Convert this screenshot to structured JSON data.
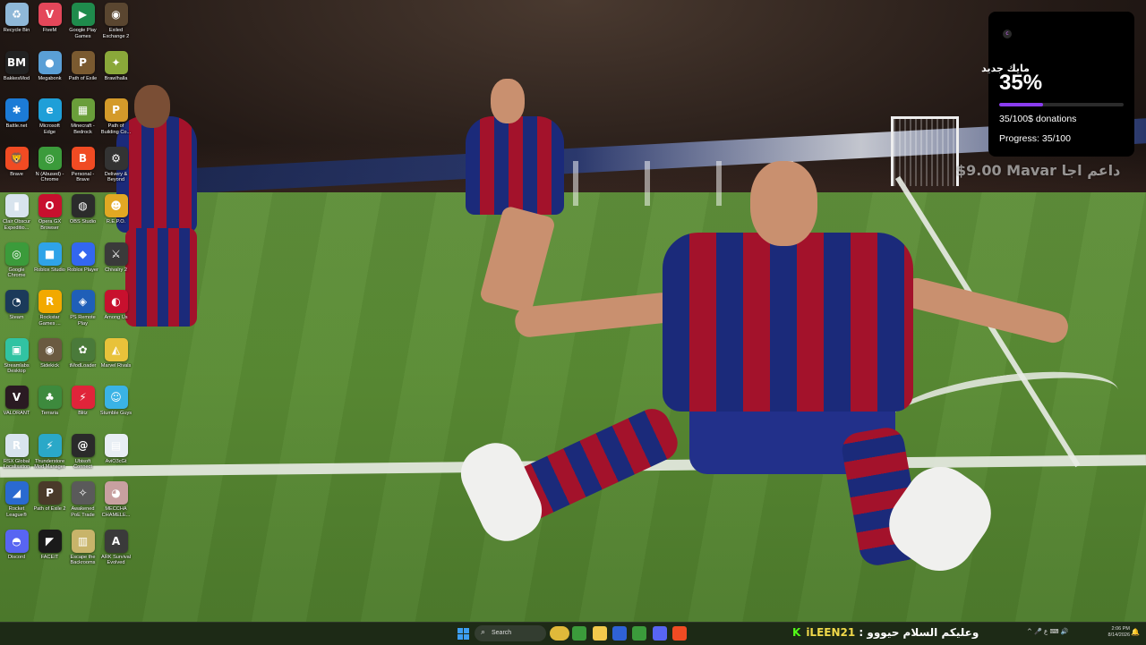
{
  "desktop_icons": [
    {
      "label": "Recycle Bin",
      "icon": "recycle-bin-icon",
      "color": "#8fb8d8",
      "glyph": "♻"
    },
    {
      "label": "FiveM",
      "icon": "fivem-icon",
      "color": "#e4475a",
      "glyph": "V"
    },
    {
      "label": "Google Play Games",
      "icon": "google-play-games-icon",
      "color": "#1f8b4c",
      "glyph": "▶"
    },
    {
      "label": "Exiled Exchange 2",
      "icon": "exiled-exchange-icon",
      "color": "#5a4630",
      "glyph": "◉"
    },
    {
      "label": "BakkesMod",
      "icon": "bakkesmod-icon",
      "color": "#222222",
      "glyph": "BM"
    },
    {
      "label": "Megabonk",
      "icon": "megabonk-icon",
      "color": "#5a9fd6",
      "glyph": "●"
    },
    {
      "label": "Path of Exile",
      "icon": "path-of-exile-icon",
      "color": "#7a5a30",
      "glyph": "P"
    },
    {
      "label": "Brawlhalla",
      "icon": "brawlhalla-icon",
      "color": "#8aa83a",
      "glyph": "✦"
    },
    {
      "label": "Battle.net",
      "icon": "battlenet-icon",
      "color": "#1c7bd6",
      "glyph": "✱"
    },
    {
      "label": "Microsoft Edge",
      "icon": "edge-icon",
      "color": "#1f9fd8",
      "glyph": "e"
    },
    {
      "label": "Minecraft - Bedrock",
      "icon": "minecraft-icon",
      "color": "#6a9e3a",
      "glyph": "▦"
    },
    {
      "label": "Path of Building Co...",
      "icon": "path-of-building-icon",
      "color": "#d49a2a",
      "glyph": "P"
    },
    {
      "label": "Brave",
      "icon": "brave-icon",
      "color": "#f04b23",
      "glyph": "🦁"
    },
    {
      "label": "N (Abused) - Chrome",
      "icon": "chrome-icon",
      "color": "#3b9b3b",
      "glyph": "◎"
    },
    {
      "label": "Personal - Brave",
      "icon": "brave-personal-icon",
      "color": "#f04b23",
      "glyph": "B"
    },
    {
      "label": "Delivery & Beyond",
      "icon": "delivery-beyond-icon",
      "color": "#333333",
      "glyph": "⚙"
    },
    {
      "label": "Clair Obscur Expeditio...",
      "icon": "clair-obscur-icon",
      "color": "#d8e4ee",
      "glyph": "▮"
    },
    {
      "label": "Opera GX Browser",
      "icon": "opera-gx-icon",
      "color": "#c8102e",
      "glyph": "O"
    },
    {
      "label": "OBS Studio",
      "icon": "obs-icon",
      "color": "#2b2b2b",
      "glyph": "◍"
    },
    {
      "label": "R.E.P.O.",
      "icon": "repo-icon",
      "color": "#e2a823",
      "glyph": "☻"
    },
    {
      "label": "Google Chrome",
      "icon": "google-chrome-icon",
      "color": "#3b9b3b",
      "glyph": "◎"
    },
    {
      "label": "Roblox Studio",
      "icon": "roblox-studio-icon",
      "color": "#2fa3e8",
      "glyph": "■"
    },
    {
      "label": "Roblox Player",
      "icon": "roblox-player-icon",
      "color": "#3367f0",
      "glyph": "◆"
    },
    {
      "label": "Chivalry 2",
      "icon": "chivalry-icon",
      "color": "#3a3a3a",
      "glyph": "⚔"
    },
    {
      "label": "Steam",
      "icon": "steam-icon",
      "color": "#1b3a5a",
      "glyph": "◔"
    },
    {
      "label": "Rockstar Games ...",
      "icon": "rockstar-icon",
      "color": "#f2a900",
      "glyph": "R"
    },
    {
      "label": "PS Remote Play",
      "icon": "ps-remote-play-icon",
      "color": "#1f5fb8",
      "glyph": "◈"
    },
    {
      "label": "Among Us",
      "icon": "among-us-icon",
      "color": "#c8102e",
      "glyph": "◐"
    },
    {
      "label": "Streamlabs Desktop",
      "icon": "streamlabs-icon",
      "color": "#31c3a2",
      "glyph": "▣"
    },
    {
      "label": "Sidekick",
      "icon": "sidekick-icon",
      "color": "#6a5a40",
      "glyph": "◉"
    },
    {
      "label": "tModLoader",
      "icon": "tmodloader-icon",
      "color": "#4a7a3a",
      "glyph": "✿"
    },
    {
      "label": "Marvel Rivals",
      "icon": "marvel-rivals-icon",
      "color": "#e8c23a",
      "glyph": "◭"
    },
    {
      "label": "VALORANT",
      "icon": "valorant-icon",
      "color": "#2a1a22",
      "glyph": "V"
    },
    {
      "label": "Terraria",
      "icon": "terraria-icon",
      "color": "#3d8a3d",
      "glyph": "♣"
    },
    {
      "label": "Blitz",
      "icon": "blitz-icon",
      "color": "#e0243a",
      "glyph": "⚡"
    },
    {
      "label": "Stumble Guys",
      "icon": "stumble-guys-icon",
      "color": "#3ab3e6",
      "glyph": "☺"
    },
    {
      "label": "RSX Global Localisation",
      "icon": "rsx-icon",
      "color": "#d8e4ee",
      "glyph": "R"
    },
    {
      "label": "Thunderstore Mod Manager",
      "icon": "thunderstore-icon",
      "color": "#2aa8c8",
      "glyph": "⚡"
    },
    {
      "label": "Ubisoft Connect",
      "icon": "ubisoft-icon",
      "color": "#2a2a2a",
      "glyph": "@"
    },
    {
      "label": "AviO3cGt",
      "icon": "document-icon",
      "color": "#e8eef4",
      "glyph": "▤"
    },
    {
      "label": "Rocket League®",
      "icon": "rocket-league-icon",
      "color": "#2a6ad0",
      "glyph": "◢"
    },
    {
      "label": "Path of Exile 2",
      "icon": "path-of-exile-2-icon",
      "color": "#4a3a2a",
      "glyph": "P"
    },
    {
      "label": "Awakened PoE Trade",
      "icon": "awakened-poe-icon",
      "color": "#5a5a5a",
      "glyph": "✧"
    },
    {
      "label": "MECCHA CHAMELE...",
      "icon": "meccha-icon",
      "color": "#c8a0a0",
      "glyph": "◕"
    },
    {
      "label": "Discord",
      "icon": "discord-icon",
      "color": "#5865f2",
      "glyph": "◓"
    },
    {
      "label": "FACEIT",
      "icon": "faceit-icon",
      "color": "#1a1a1a",
      "glyph": "◤"
    },
    {
      "label": "Escape the Backrooms",
      "icon": "escape-backrooms-icon",
      "color": "#c8b46a",
      "glyph": "▥"
    },
    {
      "label": "ARK Survival Evolved",
      "icon": "ark-icon",
      "color": "#3a3a3a",
      "glyph": "A"
    }
  ],
  "donation_widget": {
    "logo": "c",
    "title": "مايك جديد",
    "percent_text": "35%",
    "progress_fraction": 0.35,
    "donations_text": "35/100$ donations",
    "progress_text": "Progress: 35/100",
    "accent_color": "#8a3cf0"
  },
  "overlay_ticker": "$9.00 Mavar داعم اجا",
  "taskbar": {
    "search_placeholder": "Search",
    "apps": [
      {
        "icon": "file-explorer-yellow-icon",
        "color": "#e0b93a"
      },
      {
        "icon": "chrome-taskbar-icon",
        "color": "#3b9b3b"
      },
      {
        "icon": "folder-icon",
        "color": "#f2c94c"
      },
      {
        "icon": "sidekick-taskbar-icon",
        "color": "#2f62d6"
      },
      {
        "icon": "chrome-alt-taskbar-icon",
        "color": "#3b9b3b"
      },
      {
        "icon": "discord-taskbar-icon",
        "color": "#5865f2"
      },
      {
        "icon": "brave-taskbar-icon",
        "color": "#f04b23"
      }
    ],
    "chat_platform_glyph": "K",
    "chat_user": "iLEEN21",
    "chat_separator": " : ",
    "chat_message": "وعليكم السلام حيووو",
    "tray_icons": "^ 🎤 ع ⌨ 🔊",
    "clock_time": "2:06 PM",
    "clock_date": "8/14/2026"
  }
}
